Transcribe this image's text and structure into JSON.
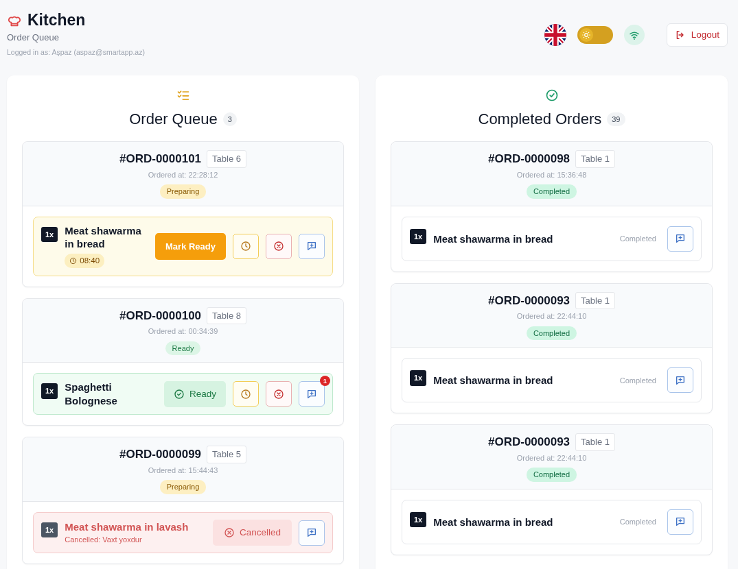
{
  "header": {
    "title": "Kitchen",
    "subtitle": "Order Queue",
    "logged_in": "Logged in as: Aşpaz (aspaz@smartapp.az)",
    "dark_mode": false,
    "online": true,
    "logout": "Logout"
  },
  "columns": [
    {
      "kind": "queue",
      "title": "Order Queue",
      "count": "3",
      "orders": [
        {
          "number": "#ORD-0000101",
          "table": "Table 6",
          "ordered_at": "Ordered at: 22:28:12",
          "status": "Preparing",
          "kind": "preparing",
          "items": [
            {
              "kind": "preparing",
              "qty": "1x",
              "name": "Meat shawarma in bread",
              "timer": "08:40",
              "action": "Mark Ready"
            }
          ]
        },
        {
          "number": "#ORD-0000100",
          "table": "Table 8",
          "ordered_at": "Ordered at: 00:34:39",
          "status": "Ready",
          "kind": "ready",
          "items": [
            {
              "kind": "ready",
              "qty": "1x",
              "name": "Spaghetti Bolognese",
              "action": "Ready",
              "note_count": "1"
            }
          ]
        },
        {
          "number": "#ORD-0000099",
          "table": "Table 5",
          "ordered_at": "Ordered at: 15:44:43",
          "status": "Preparing",
          "kind": "preparing",
          "items": [
            {
              "kind": "cancelled",
              "qty": "1x",
              "name": "Meat shawarma in lavash",
              "reason": "Cancelled: Vaxt yoxdur",
              "action": "Cancelled"
            }
          ]
        }
      ]
    },
    {
      "kind": "completed",
      "title": "Completed Orders",
      "count": "39",
      "orders": [
        {
          "number": "#ORD-0000098",
          "table": "Table 1",
          "ordered_at": "Ordered at: 15:36:48",
          "status": "Completed",
          "kind": "completed",
          "items": [
            {
              "kind": "completed",
              "qty": "1x",
              "name": "Meat shawarma in bread",
              "action": "Completed"
            }
          ]
        },
        {
          "number": "#ORD-0000093",
          "table": "Table 1",
          "ordered_at": "Ordered at: 22:44:10",
          "status": "Completed",
          "kind": "completed",
          "items": [
            {
              "kind": "completed",
              "qty": "1x",
              "name": "Meat shawarma in bread",
              "action": "Completed"
            }
          ]
        },
        {
          "number": "#ORD-0000093",
          "table": "Table 1",
          "ordered_at": "Ordered at: 22:44:10",
          "status": "Completed",
          "kind": "completed",
          "items": [
            {
              "kind": "completed",
              "qty": "1x",
              "name": "Meat shawarma in bread",
              "action": "Completed"
            }
          ]
        }
      ]
    }
  ]
}
